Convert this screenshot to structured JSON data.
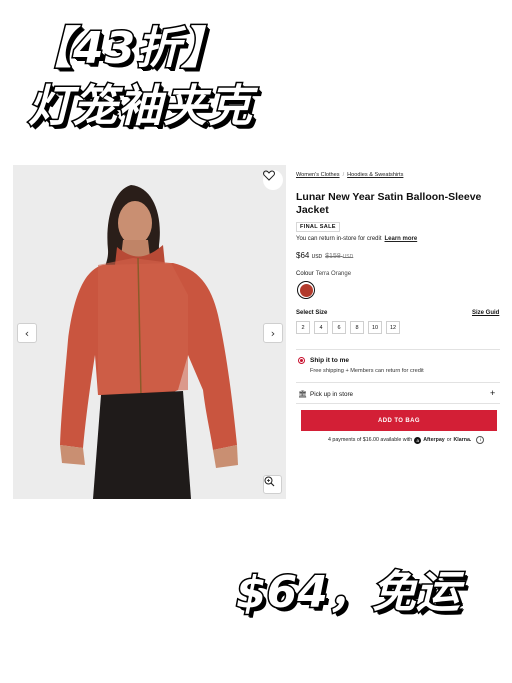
{
  "overlay": {
    "headline_top": "【43折】",
    "headline_bottom": "灯笼袖夹克",
    "price_banner": "$64，免运"
  },
  "breadcrumb": [
    "Women's Clothes",
    "Hoodies & Sweatshirts"
  ],
  "product": {
    "title": "Lunar New Year Satin Balloon-Sleeve Jacket",
    "badge": "FINAL SALE",
    "return_note": "You can return in-store for credit",
    "learn_more": "Learn more",
    "price_now": "$64",
    "price_now_currency": "USD",
    "price_was": "$158",
    "price_was_currency": "USD",
    "colour_label": "Colour",
    "colour_name": "Terra Orange",
    "colour_hex": "#b23a2c",
    "select_size_label": "Select Size",
    "size_guide_label": "Size Guid",
    "sizes": [
      "2",
      "4",
      "6",
      "8",
      "10",
      "12"
    ]
  },
  "delivery": {
    "ship_title": "Ship it to me",
    "ship_subtitle": "Free shipping + Members can return for credit",
    "pickup_label": "Pick up in store",
    "pickup_expand": "+"
  },
  "cta": {
    "add_to_bag": "ADD TO BAG",
    "installments_text": "4 payments of $16.00 available with",
    "afterpay": "Afterpay",
    "or": "or",
    "klarna": "Klarna."
  },
  "gallery": {
    "prev_icon": "chevron-left-icon",
    "next_icon": "chevron-right-icon",
    "zoom_icon": "zoom-in-icon",
    "favorite_icon": "heart-icon"
  },
  "colors": {
    "accent": "#d31f36",
    "jacket": "#c9553f"
  }
}
